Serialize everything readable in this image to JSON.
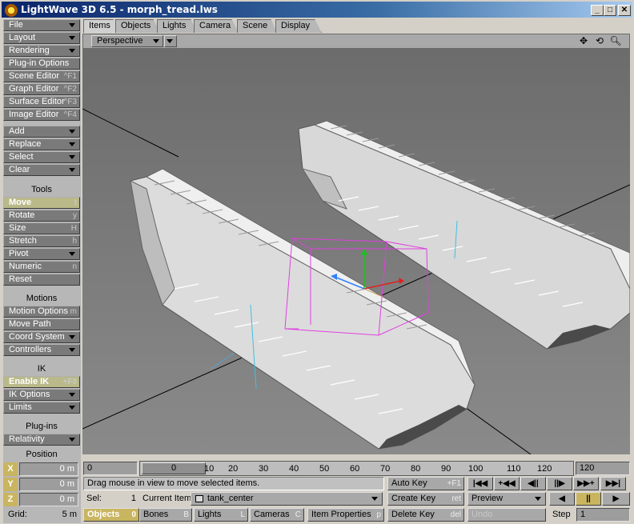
{
  "window": {
    "title": "LightWave 3D 6.5 - morph_tread.lws",
    "minimize": "_",
    "maximize": "□",
    "close": "✕"
  },
  "tabs": [
    "Items",
    "Objects",
    "Lights",
    "Camera",
    "Scene",
    "Display"
  ],
  "viewport": {
    "mode": "Perspective",
    "icons": [
      "move-view-icon",
      "rotate-view-icon",
      "zoom-icon"
    ]
  },
  "left": {
    "file": "File",
    "layout": "Layout",
    "rendering": "Rendering",
    "plugin_options": "Plug-in Options",
    "scene_editor": "Scene Editor",
    "scene_editor_key": "^F1",
    "graph_editor": "Graph Editor",
    "graph_editor_key": "^F2",
    "surface_editor": "Surface Editor",
    "surface_editor_key": "^F3",
    "image_editor": "Image Editor",
    "image_editor_key": "^F4",
    "add": "Add",
    "replace": "Replace",
    "select": "Select",
    "clear": "Clear",
    "tools_head": "Tools",
    "move": "Move",
    "move_key": "t",
    "rotate": "Rotate",
    "rotate_key": "y",
    "size": "Size",
    "size_key": "H",
    "stretch": "Stretch",
    "stretch_key": "h",
    "pivot": "Pivot",
    "numeric": "Numeric",
    "numeric_key": "n",
    "reset": "Reset",
    "motions_head": "Motions",
    "motion_options": "Motion Options",
    "motion_options_key": "m",
    "move_path": "Move Path",
    "coord_system": "Coord System",
    "controllers": "Controllers",
    "ik_head": "IK",
    "enable_ik": "Enable IK",
    "enable_ik_key": "+F8",
    "ik_options": "IK Options",
    "limits": "Limits",
    "plugins_head": "Plug-ins",
    "relativity": "Relativity"
  },
  "position": {
    "head": "Position",
    "x_label": "X",
    "x": "0 m",
    "y_label": "Y",
    "y": "0 m",
    "z_label": "Z",
    "z": "0 m",
    "grid_label": "Grid:",
    "grid": "5 m"
  },
  "timeline": {
    "start": "0",
    "current": "0",
    "end": "120",
    "ticks": [
      "10",
      "20",
      "30",
      "40",
      "50",
      "60",
      "70",
      "80",
      "90",
      "100",
      "110",
      "120"
    ]
  },
  "status": {
    "message": "Drag mouse in view to move selected items.",
    "sel_label": "Sel:",
    "sel": "1",
    "current_item_label": "Current Item",
    "current_item": "tank_center"
  },
  "keys": {
    "auto_key": "Auto Key",
    "auto_key_hint": "+F1",
    "create_key": "Create Key",
    "create_key_hint": "ret",
    "delete_key": "Delete Key",
    "delete_key_hint": "del",
    "preview": "Preview",
    "undo": "Undo",
    "step_label": "Step",
    "step": "1"
  },
  "transport": [
    "|◀◀",
    "+◀◀",
    "◀||",
    "||▶",
    "▶▶+",
    "▶▶|"
  ],
  "playback": [
    "◀",
    "||",
    "▶"
  ],
  "bottom_tabs": {
    "objects": "Objects",
    "objects_count": "0",
    "bones": "Bones",
    "bones_key": "B",
    "lights": "Lights",
    "lights_key": "L",
    "cameras": "Cameras",
    "cameras_key": "C",
    "item_properties": "Item Properties",
    "item_properties_key": "p"
  }
}
